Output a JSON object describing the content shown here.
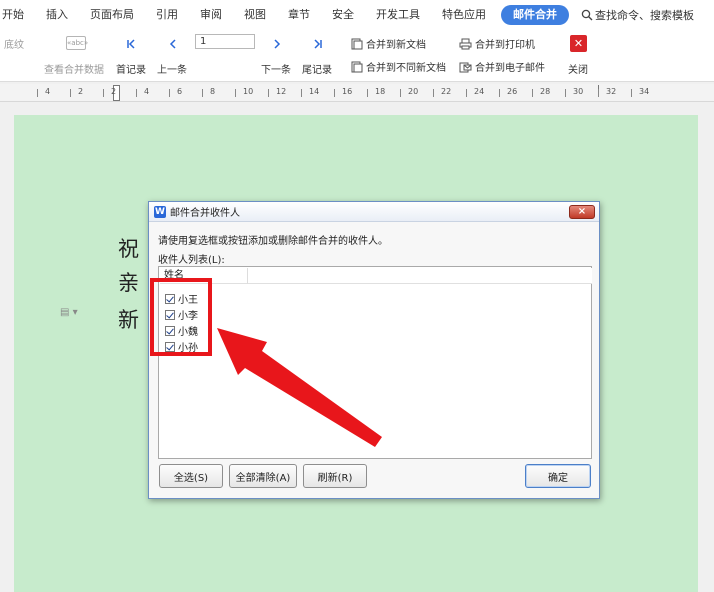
{
  "menubar": {
    "tabs": [
      {
        "label": "开始"
      },
      {
        "label": "插入"
      },
      {
        "label": "页面布局"
      },
      {
        "label": "引用"
      },
      {
        "label": "审阅"
      },
      {
        "label": "视图"
      },
      {
        "label": "章节"
      },
      {
        "label": "安全"
      },
      {
        "label": "开发工具"
      },
      {
        "label": "特色应用"
      },
      {
        "label": "邮件合并"
      }
    ],
    "active_tab": "邮件合并",
    "search_label": "查找命令、搜索模板",
    "accent_color": "#3e7fe0"
  },
  "ribbon": {
    "highlight_label": "底纹",
    "merge_fields_label": "«abc»",
    "view_merged_label": "查看合并数据",
    "first_record_label": "首记录",
    "prev_label": "上一条",
    "record_value": "1",
    "next_label": "下一条",
    "last_record_label": "尾记录",
    "merge_new_doc_label": "合并到新文档",
    "merge_diff_doc_label": "合并到不同新文档",
    "merge_printer_label": "合并到打印机",
    "merge_email_label": "合并到电子邮件",
    "close_label": "关闭"
  },
  "ruler": {
    "numbers": [
      "4",
      "2",
      "2",
      "4",
      "6",
      "8",
      "10",
      "12",
      "14",
      "16",
      "18",
      "20",
      "22",
      "24",
      "26",
      "28",
      "30",
      "32",
      "34"
    ]
  },
  "document": {
    "line1": "祝",
    "line2": "亲",
    "line3": "新",
    "page_color": "#c7ebcc"
  },
  "dialog": {
    "title": "邮件合并收件人",
    "logo_letter": "W",
    "close_symbol": "×",
    "hint": "请使用复选框或按钮添加或删除邮件合并的收件人。",
    "list_label": "收件人列表(L):",
    "column_name": "姓名",
    "recipients": [
      {
        "name": "小王",
        "checked": true
      },
      {
        "name": "小李",
        "checked": true
      },
      {
        "name": "小魏",
        "checked": true
      },
      {
        "name": "小孙",
        "checked": true
      }
    ],
    "select_all_label": "全选(S)",
    "clear_all_label": "全部清除(A)",
    "refresh_label": "刷新(R)",
    "ok_label": "确定"
  },
  "annotation": {
    "color": "#e8161b"
  }
}
